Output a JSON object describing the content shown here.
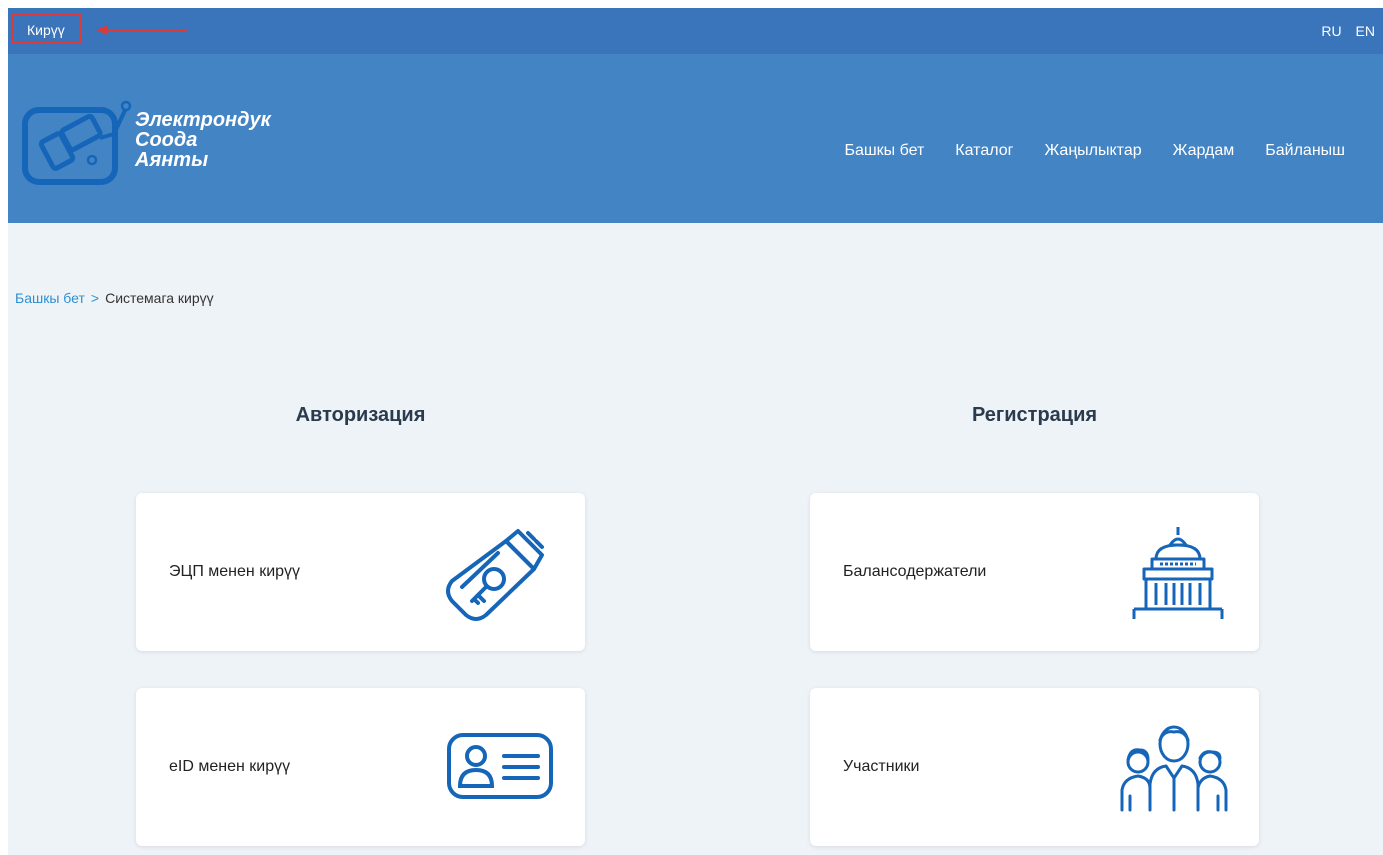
{
  "topbar": {
    "login_label": "Кирүү",
    "languages": [
      "RU",
      "EN"
    ]
  },
  "brand": {
    "line1": "Электрондук",
    "line2": "Соода",
    "line3": "Аянты"
  },
  "nav": {
    "items": [
      "Башкы бет",
      "Каталог",
      "Жаңылыктар",
      "Жардам",
      "Байланыш"
    ]
  },
  "breadcrumb": {
    "home": "Башкы бет",
    "separator": ">",
    "current": "Системага кирүү"
  },
  "auth": {
    "title": "Авторизация",
    "cards": [
      {
        "label": "ЭЦП менен кирүү",
        "icon": "usb-key-icon"
      },
      {
        "label": "eID менен кирүү",
        "icon": "id-card-icon"
      }
    ]
  },
  "register": {
    "title": "Регистрация",
    "cards": [
      {
        "label": "Балансодержатели",
        "icon": "government-building-icon"
      },
      {
        "label": "Участники",
        "icon": "people-group-icon"
      }
    ]
  },
  "colors": {
    "topbar": "#3a74bb",
    "header": "#4384c5",
    "page_bg": "#eef3f8",
    "accent_link": "#2f8fd0",
    "icon_blue": "#1565b8",
    "highlight_red": "#d93a3a"
  }
}
